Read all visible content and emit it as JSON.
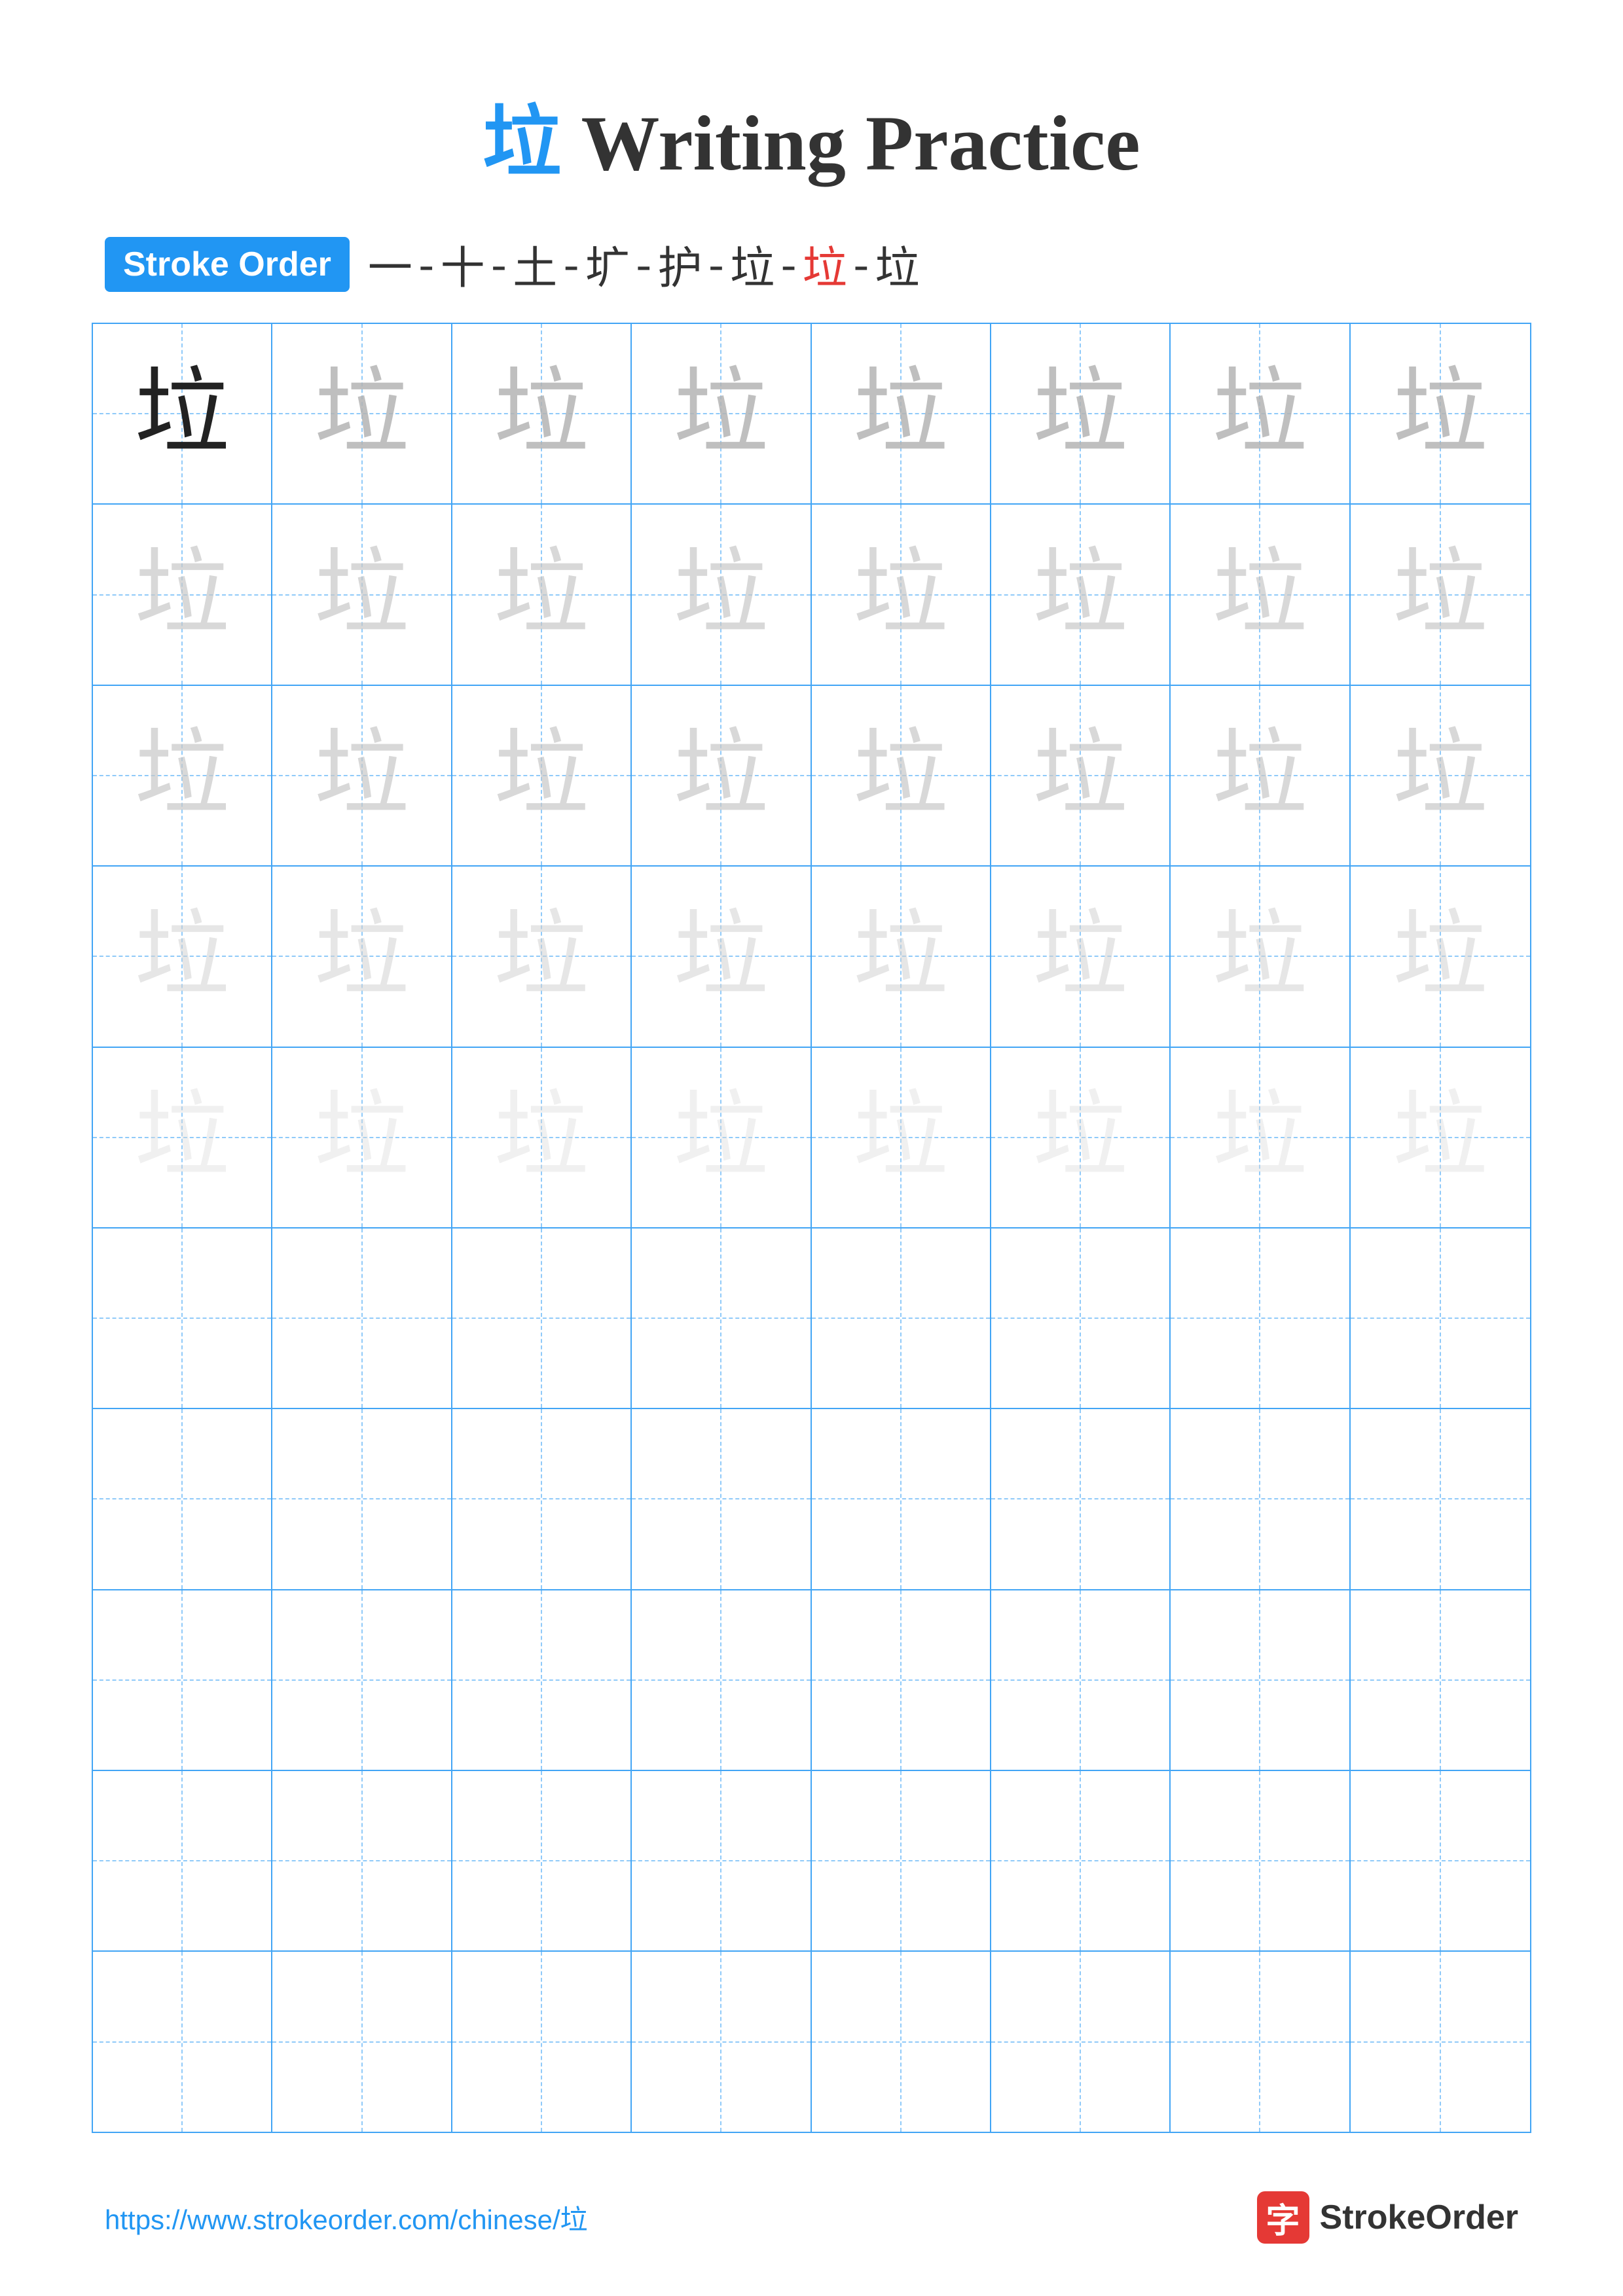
{
  "title": {
    "char": "垃",
    "rest": " Writing Practice"
  },
  "stroke_order": {
    "badge_label": "Stroke Order",
    "sequence": [
      "一",
      "十",
      "土",
      "圹",
      "护",
      "垃",
      "垃",
      "垃"
    ]
  },
  "grid": {
    "rows": 10,
    "cols": 8,
    "char": "垃",
    "guide_rows": 5,
    "practice_rows": 5
  },
  "footer": {
    "url": "https://www.strokeorder.com/chinese/垃",
    "logo_char": "字",
    "logo_text": "StrokeOrder"
  }
}
